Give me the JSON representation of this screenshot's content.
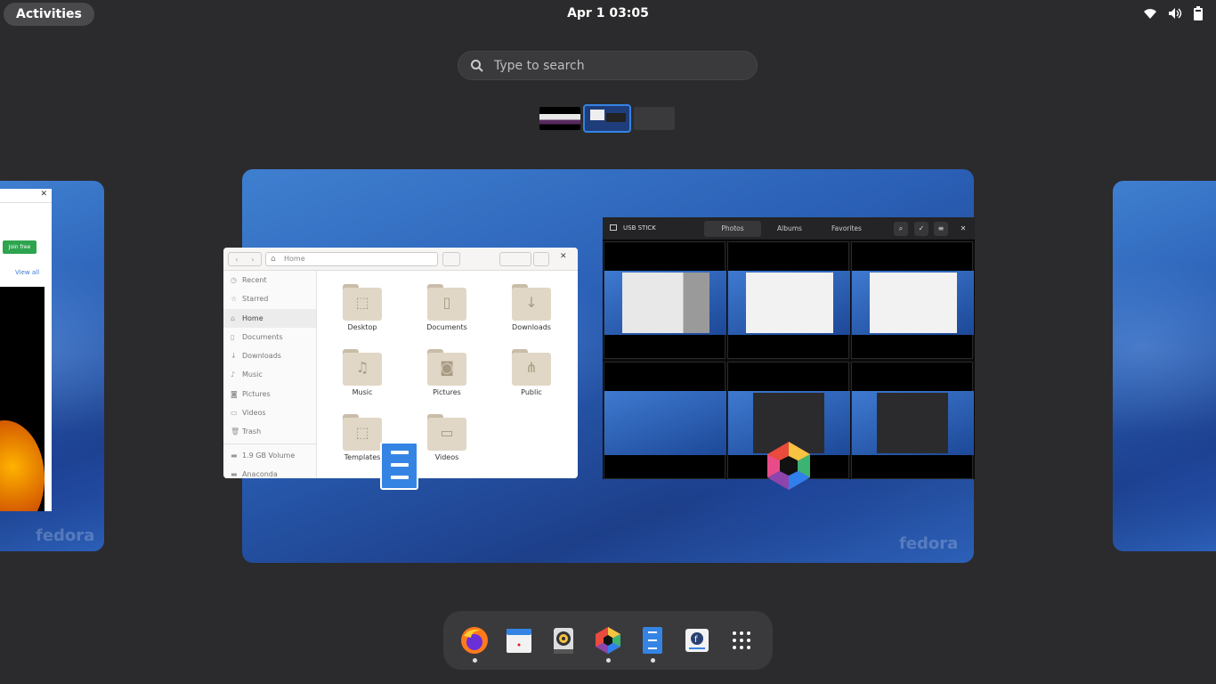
{
  "topbar": {
    "activities_label": "Activities",
    "clock": "Apr 1  03:05",
    "tray_icons": [
      "wifi-icon",
      "volume-icon",
      "battery-icon"
    ]
  },
  "search": {
    "placeholder": "Type to search"
  },
  "workspaces": {
    "count": 3,
    "active_index": 1
  },
  "left_window": {
    "join_label": "Join free",
    "view_all_label": "View all"
  },
  "files_window": {
    "path": "Home",
    "sidebar": [
      {
        "label": "Recent",
        "icon": "clock-icon"
      },
      {
        "label": "Starred",
        "icon": "star-icon"
      },
      {
        "label": "Home",
        "icon": "home-icon",
        "active": true
      },
      {
        "label": "Documents",
        "icon": "document-icon"
      },
      {
        "label": "Downloads",
        "icon": "download-icon"
      },
      {
        "label": "Music",
        "icon": "music-icon"
      },
      {
        "label": "Pictures",
        "icon": "camera-icon"
      },
      {
        "label": "Videos",
        "icon": "video-icon"
      },
      {
        "label": "Trash",
        "icon": "trash-icon"
      },
      {
        "label": "1.9 GB Volume",
        "icon": "drive-icon"
      },
      {
        "label": "Anaconda",
        "icon": "drive-icon"
      }
    ],
    "folders": [
      "Desktop",
      "Documents",
      "Downloads",
      "Music",
      "Pictures",
      "Public",
      "Templates",
      "Videos"
    ]
  },
  "photos_window": {
    "title": "USB STICK",
    "tabs": [
      "Photos",
      "Albums",
      "Favorites"
    ],
    "active_tab": "Photos"
  },
  "watermark": "fedora",
  "dash": {
    "apps": [
      {
        "name": "firefox-icon",
        "running": true
      },
      {
        "name": "calendar-icon",
        "running": false
      },
      {
        "name": "rhythmbox-icon",
        "running": false
      },
      {
        "name": "photos-icon",
        "running": true
      },
      {
        "name": "files-icon",
        "running": true
      },
      {
        "name": "fedora-media-writer-icon",
        "running": false
      },
      {
        "name": "show-apps-icon",
        "running": false
      }
    ]
  },
  "colors": {
    "accent": "#3584e4",
    "panel": "#2b2b2d",
    "dash": "#3a3a3d"
  }
}
